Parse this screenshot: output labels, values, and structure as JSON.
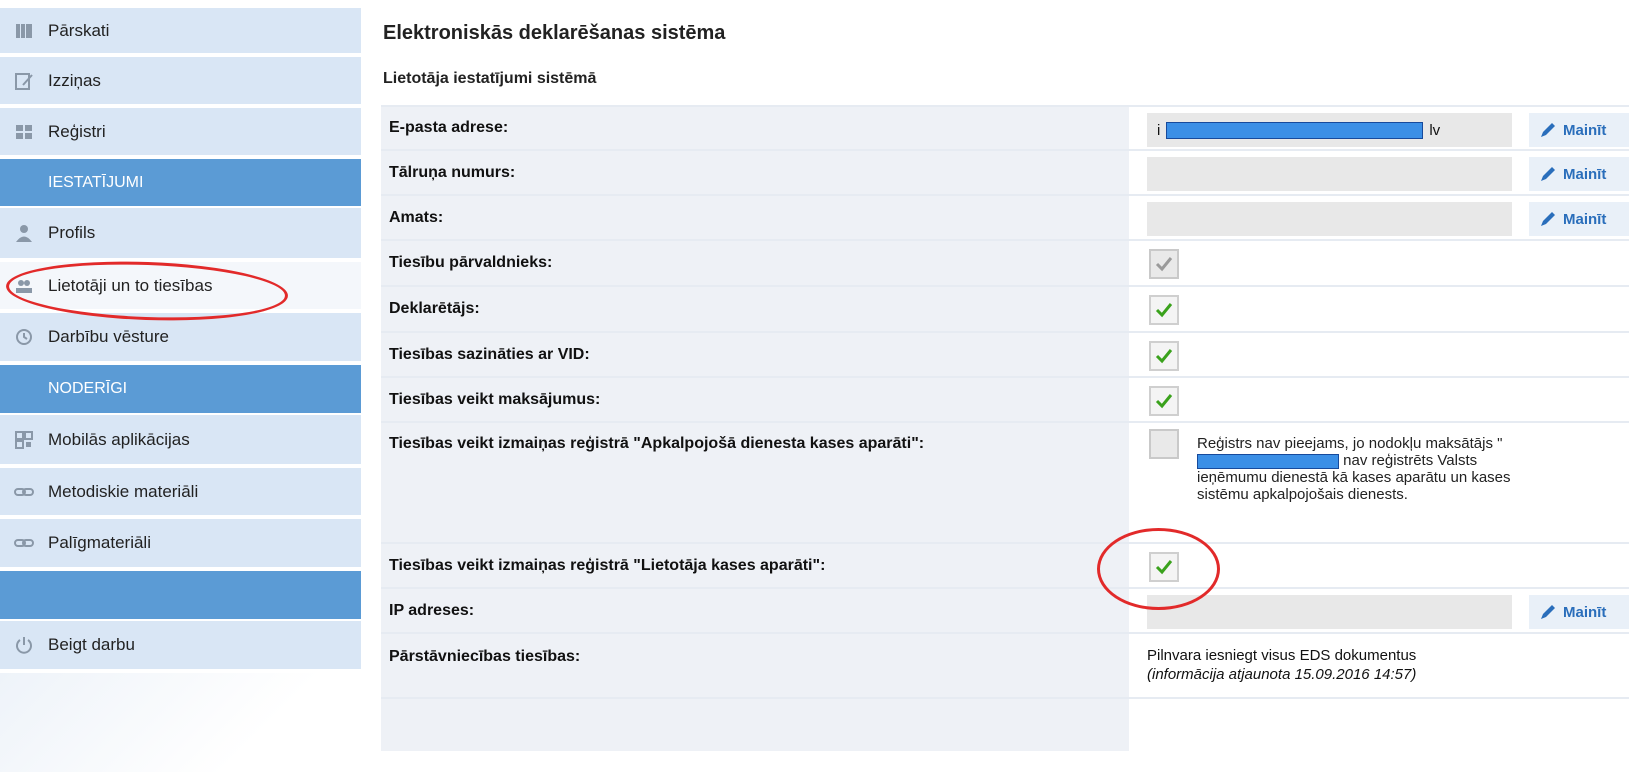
{
  "sidebar": {
    "items": [
      {
        "label": "Pārskati",
        "icon": "reports-icon"
      },
      {
        "label": "Izziņas",
        "icon": "inquiries-icon"
      },
      {
        "label": "Reģistri",
        "icon": "registers-icon"
      },
      {
        "header": "IESTATĪJUMI"
      },
      {
        "label": "Profils",
        "icon": "profile-icon"
      },
      {
        "label": "Lietotāji un to tiesības",
        "icon": "users-icon"
      },
      {
        "label": "Darbību vēsture",
        "icon": "history-icon"
      },
      {
        "header": "NODERĪGI"
      },
      {
        "label": "Mobilās aplikācijas",
        "icon": "qr-icon"
      },
      {
        "label": "Metodiskie materiāli",
        "icon": "link-icon"
      },
      {
        "label": "Palīgmateriāli",
        "icon": "link-icon"
      },
      {
        "label": "Beigt darbu",
        "icon": "power-icon"
      }
    ]
  },
  "main": {
    "title": "Elektroniskās deklarēšanas sistēma",
    "subtitle": "Lietotāja iestatījumi sistēmā",
    "edit_label": "Mainīt",
    "email": {
      "label": "E-pasta adrese:",
      "prefix": "i",
      "suffix": "lv"
    },
    "phone": {
      "label": "Tālruņa numurs:"
    },
    "position": {
      "label": "Amats:"
    },
    "rights_admin": {
      "label": "Tiesību pārvaldnieks:",
      "checked": true,
      "disabled": true
    },
    "declarer": {
      "label": "Deklarētājs:",
      "checked": true
    },
    "contact_vid": {
      "label": "Tiesības sazināties ar VID:",
      "checked": true
    },
    "payments": {
      "label": "Tiesības veikt maksājumus:",
      "checked": true
    },
    "registry_service": {
      "label": "Tiesības veikt izmaiņas reģistrā \"Apkalpojošā dienesta kases aparāti\":",
      "checked": false,
      "note_1": "Reģistrs nav pieejams, jo nodokļu maksātājs \"",
      "note_2": "nav reģistrēts Valsts ieņēmumu dienestā kā kases aparātu un kases sistēmu apkalpojošais dienests."
    },
    "registry_user": {
      "label": "Tiesības veikt izmaiņas reģistrā \"Lietotāja kases aparāti\":",
      "checked": true
    },
    "ip": {
      "label": "IP adreses:"
    },
    "representation": {
      "label": "Pārstāvniecības tiesības:",
      "value": "Pilnvara iesniegt visus EDS dokumentus",
      "updated": "(informācija atjaunota 15.09.2016 14:57)"
    }
  },
  "colors": {
    "accent": "#5b9bd5",
    "check": "#3aa21c",
    "highlight": "#e22a2a"
  }
}
